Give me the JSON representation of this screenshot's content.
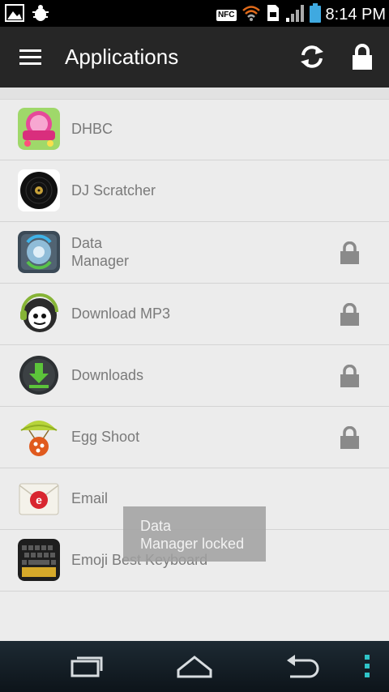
{
  "status_bar": {
    "time": "8:14 PM",
    "nfc_label": "NFC",
    "icons": [
      "image-icon",
      "bug-icon",
      "nfc-icon",
      "wifi-icon",
      "sim-icon",
      "signal-icon",
      "battery-icon"
    ]
  },
  "app_bar": {
    "title": "Applications",
    "icons": [
      "menu-icon",
      "refresh-icon",
      "lock-icon"
    ]
  },
  "apps": [
    {
      "name": "DHBC",
      "locked": false
    },
    {
      "name": "DJ Scratcher",
      "locked": false
    },
    {
      "name": "Data\nManager",
      "locked": true
    },
    {
      "name": "Download MP3",
      "locked": true
    },
    {
      "name": "Downloads",
      "locked": true
    },
    {
      "name": "Egg Shoot",
      "locked": true
    },
    {
      "name": "Email",
      "locked": false
    },
    {
      "name": "Emoji Best Keyboard",
      "locked": false
    }
  ],
  "toast": {
    "line1": "Data",
    "line2": "Manager locked"
  },
  "nav_bar": {
    "icons": [
      "recent-apps-icon",
      "home-icon",
      "back-icon",
      "overflow-menu-icon"
    ]
  },
  "colors": {
    "app_bar": "#262626",
    "background": "#ececec",
    "label_text": "#7a7a7a",
    "lock_icon": "#8a8a8a"
  }
}
